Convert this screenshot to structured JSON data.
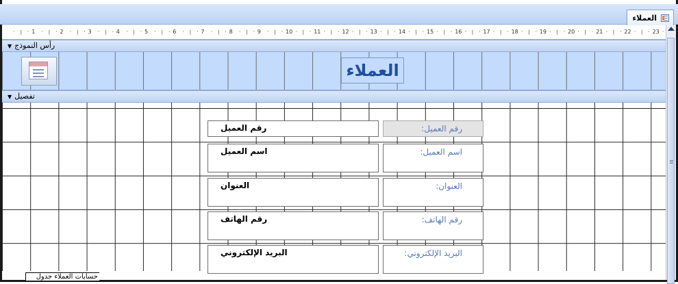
{
  "window": {
    "tab_title": "العملاء",
    "tab_icon": "form-icon"
  },
  "ruler": {
    "numbers": [
      "1",
      "2",
      "3",
      "4",
      "5",
      "6",
      "7",
      "8",
      "9",
      "10",
      "11",
      "12",
      "13",
      "14",
      "15",
      "16",
      "17",
      "18",
      "19",
      "20",
      "21",
      "22",
      "23"
    ]
  },
  "sections": {
    "form_header_label": "رأس النموذج",
    "detail_label": "تفصيل"
  },
  "header": {
    "title": "العملاء",
    "logo_icon": "form-logo-icon"
  },
  "fields": [
    {
      "control": "رقم العميل",
      "label": "رقم العميل:"
    },
    {
      "control": "اسم العميل",
      "label": "اسم العميل:"
    },
    {
      "control": "العنوان",
      "label": "العنوان:"
    },
    {
      "control": "رقم الهاتف",
      "label": "رقم الهاتف:"
    },
    {
      "control": "البريد الإلكتروني",
      "label": "البريد الإلكتروني:"
    }
  ],
  "footer": {
    "subform_label": "حسابات العملاء جدول"
  },
  "colors": {
    "header_bg": "#c3dbfd",
    "label_text": "#5779b8",
    "title_text": "#1f4f9c"
  }
}
